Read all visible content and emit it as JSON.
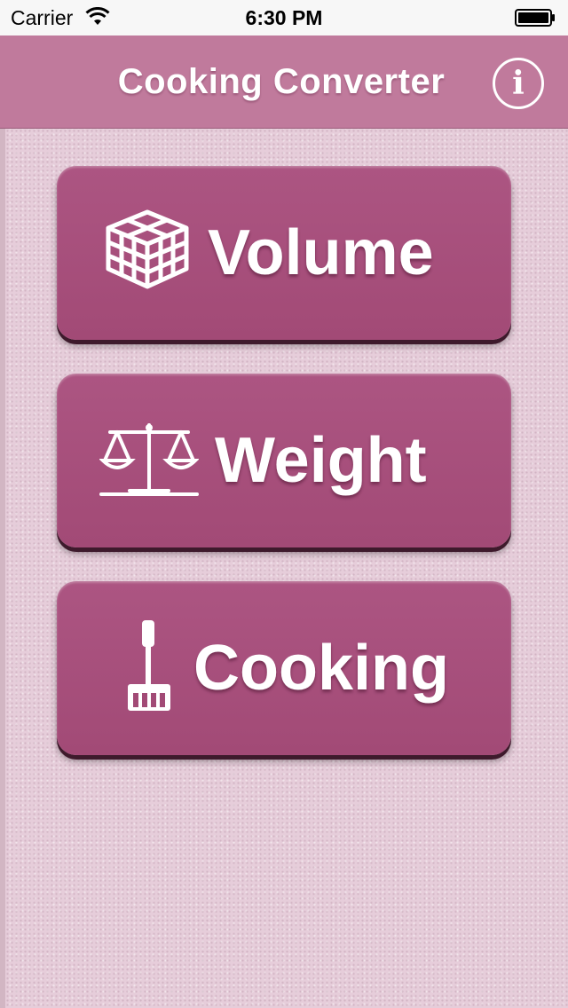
{
  "status_bar": {
    "carrier": "Carrier",
    "time": "6:30 PM"
  },
  "nav": {
    "title": "Cooking Converter",
    "info_label": "i"
  },
  "menu": [
    {
      "label": "Volume",
      "icon": "cube-icon"
    },
    {
      "label": "Weight",
      "icon": "scale-icon"
    },
    {
      "label": "Cooking",
      "icon": "spatula-icon"
    }
  ],
  "colors": {
    "nav_bar": "#c07a9c",
    "button": "#a24a76",
    "background": "#e6cdda"
  }
}
